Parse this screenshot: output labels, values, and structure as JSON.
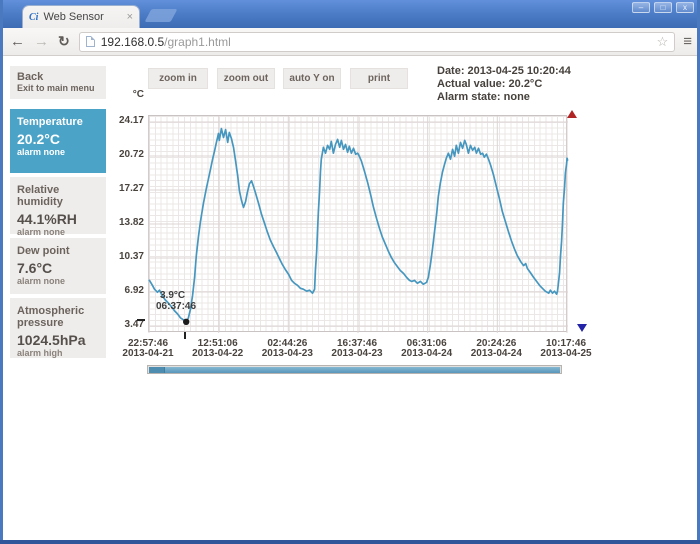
{
  "browser": {
    "tab_title": "Web Sensor",
    "favicon_text": "Ci",
    "url_host": "192.168.0.5",
    "url_path": "/graph1.html",
    "icons": {
      "back": "←",
      "forward": "→",
      "reload": "↻",
      "star": "☆",
      "menu": "≡",
      "tab_close": "×",
      "minimize": "–",
      "maximize": "□",
      "close": "x"
    }
  },
  "sidebar": {
    "back": {
      "title": "Back",
      "subtitle": "Exit to main menu"
    },
    "channels": [
      {
        "label": "Temperature",
        "value": "20.2°C",
        "alarm": "alarm none",
        "selected": true
      },
      {
        "label": "Relative humidity",
        "value": "44.1%RH",
        "alarm": "alarm none",
        "selected": false
      },
      {
        "label": "Dew point",
        "value": "7.6°C",
        "alarm": "alarm none",
        "selected": false
      },
      {
        "label": "Atmospheric pressure",
        "value": "1024.5hPa",
        "alarm": "alarm high",
        "selected": false
      }
    ]
  },
  "toolbar": {
    "buttons": [
      "zoom in",
      "zoom out",
      "auto Y on",
      "print"
    ]
  },
  "status": {
    "date": "Date: 2013-04-25 10:20:44",
    "actual": "Actual value: 20.2°C",
    "alarm": "Alarm state: none"
  },
  "chart_data": {
    "type": "line",
    "ylabel": "°C",
    "y_ticks": [
      24.17,
      20.72,
      17.27,
      13.82,
      10.37,
      6.92,
      3.47
    ],
    "ylim": [
      2.9,
      24.8
    ],
    "grid": true,
    "line_color": "#4697bf",
    "x_ticks": [
      {
        "time": "22:57:46",
        "date": "2013-04-21"
      },
      {
        "time": "12:51:06",
        "date": "2013-04-22"
      },
      {
        "time": "02:44:26",
        "date": "2013-04-23"
      },
      {
        "time": "16:37:46",
        "date": "2013-04-23"
      },
      {
        "time": "06:31:06",
        "date": "2013-04-24"
      },
      {
        "time": "20:24:26",
        "date": "2013-04-24"
      },
      {
        "time": "10:17:46",
        "date": "2013-04-25"
      }
    ],
    "min_marker": {
      "t": 0.089,
      "value": 3.9,
      "label_value": "3.9°C",
      "label_time": "06:37:46"
    },
    "series": [
      {
        "name": "Temperature",
        "points": [
          [
            0,
            8.1
          ],
          [
            0.007,
            7.6
          ],
          [
            0.012,
            7.2
          ],
          [
            0.019,
            6.9
          ],
          [
            0.024,
            7.1
          ],
          [
            0.031,
            6.5
          ],
          [
            0.038,
            6.1
          ],
          [
            0.045,
            5.8
          ],
          [
            0.053,
            5.4
          ],
          [
            0.06,
            5.0
          ],
          [
            0.067,
            4.7
          ],
          [
            0.074,
            4.3
          ],
          [
            0.081,
            4.1
          ],
          [
            0.089,
            3.9
          ],
          [
            0.093,
            4.3
          ],
          [
            0.098,
            5.2
          ],
          [
            0.103,
            6.6
          ],
          [
            0.108,
            8.4
          ],
          [
            0.112,
            10.6
          ],
          [
            0.117,
            12.5
          ],
          [
            0.122,
            14.1
          ],
          [
            0.129,
            15.9
          ],
          [
            0.136,
            17.4
          ],
          [
            0.144,
            19.0
          ],
          [
            0.151,
            20.4
          ],
          [
            0.156,
            21.3
          ],
          [
            0.16,
            22.1
          ],
          [
            0.165,
            23.0
          ],
          [
            0.167,
            22.3
          ],
          [
            0.172,
            23.5
          ],
          [
            0.177,
            22.6
          ],
          [
            0.182,
            23.4
          ],
          [
            0.187,
            22.1
          ],
          [
            0.191,
            23.1
          ],
          [
            0.196,
            22.5
          ],
          [
            0.201,
            21.6
          ],
          [
            0.206,
            20.2
          ],
          [
            0.211,
            18.7
          ],
          [
            0.215,
            17.2
          ],
          [
            0.22,
            16.2
          ],
          [
            0.225,
            15.5
          ],
          [
            0.23,
            16.1
          ],
          [
            0.234,
            17.0
          ],
          [
            0.239,
            17.9
          ],
          [
            0.244,
            18.2
          ],
          [
            0.249,
            17.6
          ],
          [
            0.254,
            16.9
          ],
          [
            0.261,
            15.9
          ],
          [
            0.268,
            14.8
          ],
          [
            0.275,
            13.9
          ],
          [
            0.282,
            13.0
          ],
          [
            0.289,
            12.2
          ],
          [
            0.297,
            11.5
          ],
          [
            0.304,
            10.9
          ],
          [
            0.311,
            10.3
          ],
          [
            0.318,
            9.7
          ],
          [
            0.325,
            9.2
          ],
          [
            0.333,
            8.7
          ],
          [
            0.34,
            8.1
          ],
          [
            0.347,
            7.8
          ],
          [
            0.354,
            7.6
          ],
          [
            0.361,
            7.3
          ],
          [
            0.368,
            7.2
          ],
          [
            0.376,
            7.0
          ],
          [
            0.383,
            7.1
          ],
          [
            0.39,
            6.8
          ],
          [
            0.395,
            7.2
          ],
          [
            0.397,
            9.1
          ],
          [
            0.4,
            11.1
          ],
          [
            0.402,
            13.1
          ],
          [
            0.404,
            15.1
          ],
          [
            0.407,
            17.2
          ],
          [
            0.409,
            19.2
          ],
          [
            0.411,
            20.4
          ],
          [
            0.416,
            21.6
          ],
          [
            0.421,
            21.0
          ],
          [
            0.426,
            21.8
          ],
          [
            0.431,
            21.4
          ],
          [
            0.435,
            22.2
          ],
          [
            0.44,
            21.0
          ],
          [
            0.445,
            21.9
          ],
          [
            0.45,
            22.4
          ],
          [
            0.455,
            21.6
          ],
          [
            0.459,
            22.3
          ],
          [
            0.464,
            21.4
          ],
          [
            0.469,
            21.9
          ],
          [
            0.474,
            21.1
          ],
          [
            0.478,
            21.7
          ],
          [
            0.483,
            21.0
          ],
          [
            0.488,
            21.5
          ],
          [
            0.493,
            20.9
          ],
          [
            0.498,
            21.0
          ],
          [
            0.502,
            20.7
          ],
          [
            0.507,
            20.2
          ],
          [
            0.514,
            19.2
          ],
          [
            0.522,
            18.0
          ],
          [
            0.529,
            16.8
          ],
          [
            0.536,
            15.5
          ],
          [
            0.543,
            14.4
          ],
          [
            0.55,
            13.4
          ],
          [
            0.557,
            12.5
          ],
          [
            0.565,
            11.7
          ],
          [
            0.572,
            11.0
          ],
          [
            0.579,
            10.4
          ],
          [
            0.586,
            9.9
          ],
          [
            0.593,
            9.5
          ],
          [
            0.6,
            9.1
          ],
          [
            0.608,
            8.8
          ],
          [
            0.615,
            8.4
          ],
          [
            0.622,
            8.1
          ],
          [
            0.627,
            8.0
          ],
          [
            0.634,
            8.1
          ],
          [
            0.641,
            7.8
          ],
          [
            0.648,
            8.0
          ],
          [
            0.655,
            7.7
          ],
          [
            0.663,
            7.9
          ],
          [
            0.667,
            8.4
          ],
          [
            0.672,
            9.7
          ],
          [
            0.677,
            11.3
          ],
          [
            0.682,
            13.1
          ],
          [
            0.687,
            14.9
          ],
          [
            0.691,
            16.6
          ],
          [
            0.696,
            18.0
          ],
          [
            0.701,
            19.1
          ],
          [
            0.706,
            19.9
          ],
          [
            0.71,
            20.5
          ],
          [
            0.715,
            21.0
          ],
          [
            0.72,
            20.4
          ],
          [
            0.725,
            21.4
          ],
          [
            0.73,
            20.7
          ],
          [
            0.734,
            21.8
          ],
          [
            0.739,
            21.0
          ],
          [
            0.744,
            22.1
          ],
          [
            0.749,
            21.5
          ],
          [
            0.754,
            22.3
          ],
          [
            0.758,
            21.9
          ],
          [
            0.763,
            21.0
          ],
          [
            0.768,
            21.8
          ],
          [
            0.773,
            21.3
          ],
          [
            0.778,
            21.6
          ],
          [
            0.782,
            21.0
          ],
          [
            0.787,
            21.5
          ],
          [
            0.792,
            20.9
          ],
          [
            0.797,
            21.0
          ],
          [
            0.801,
            20.6
          ],
          [
            0.806,
            20.9
          ],
          [
            0.811,
            20.4
          ],
          [
            0.816,
            19.8
          ],
          [
            0.823,
            18.8
          ],
          [
            0.83,
            17.6
          ],
          [
            0.837,
            16.4
          ],
          [
            0.844,
            15.1
          ],
          [
            0.852,
            14.0
          ],
          [
            0.859,
            13.0
          ],
          [
            0.866,
            12.1
          ],
          [
            0.873,
            11.3
          ],
          [
            0.88,
            10.6
          ],
          [
            0.888,
            10.0
          ],
          [
            0.895,
            9.6
          ],
          [
            0.9,
            9.8
          ],
          [
            0.904,
            9.3
          ],
          [
            0.911,
            8.9
          ],
          [
            0.919,
            8.4
          ],
          [
            0.926,
            8.0
          ],
          [
            0.933,
            7.6
          ],
          [
            0.94,
            7.3
          ],
          [
            0.947,
            7.0
          ],
          [
            0.955,
            6.8
          ],
          [
            0.959,
            7.1
          ],
          [
            0.964,
            6.8
          ],
          [
            0.969,
            7.0
          ],
          [
            0.974,
            6.7
          ],
          [
            0.976,
            7.0
          ],
          [
            0.978,
            7.7
          ],
          [
            0.981,
            8.9
          ],
          [
            0.983,
            10.4
          ],
          [
            0.986,
            12.1
          ],
          [
            0.988,
            13.9
          ],
          [
            0.99,
            15.9
          ],
          [
            0.993,
            17.6
          ],
          [
            0.995,
            19.0
          ],
          [
            0.998,
            20.0
          ],
          [
            0.999,
            20.5
          ],
          [
            1,
            20.3
          ]
        ]
      }
    ]
  }
}
